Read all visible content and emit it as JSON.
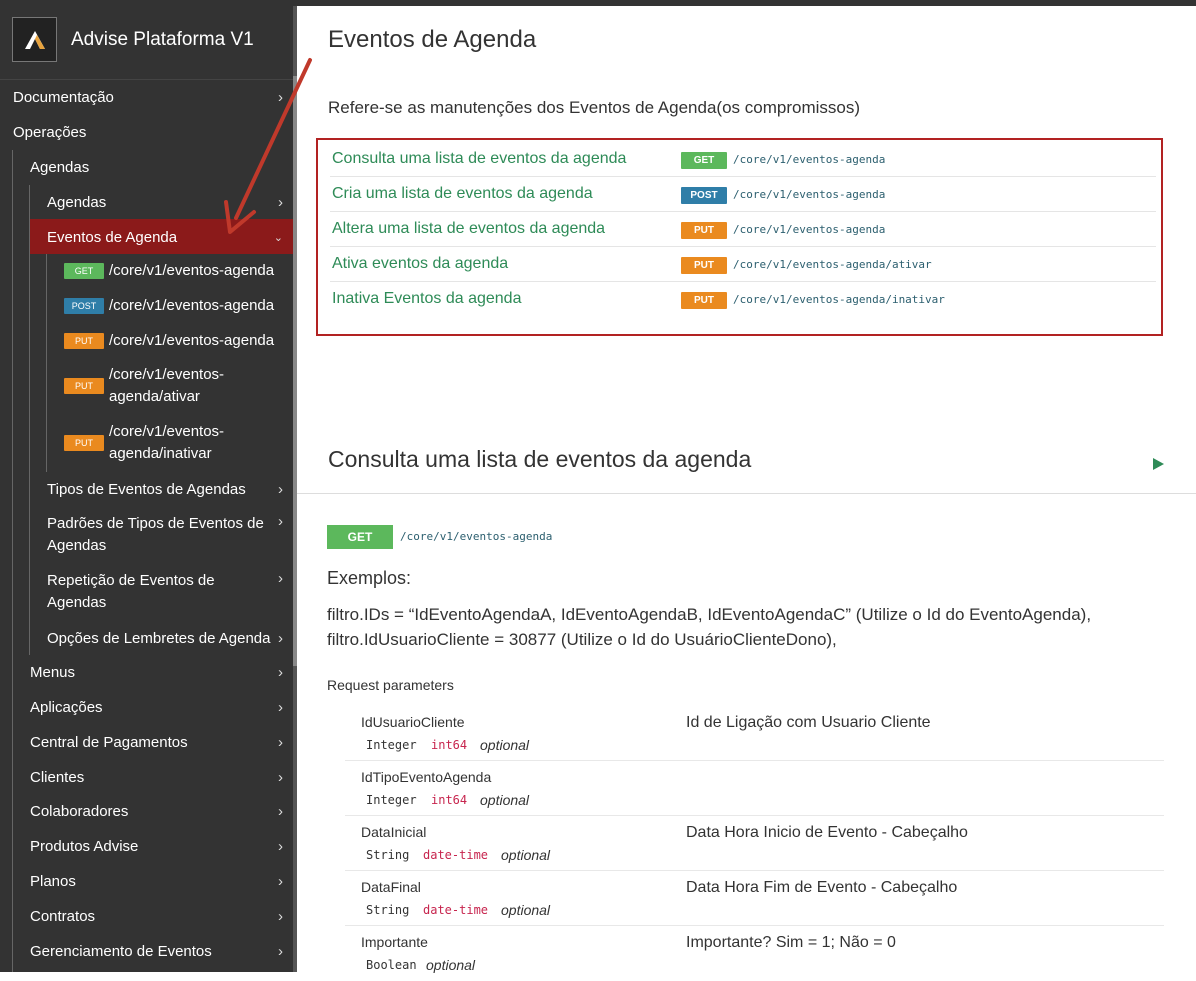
{
  "app": {
    "title": "Advise Plataforma V1"
  },
  "sidebar": {
    "top_items": [
      {
        "label": "Documentação"
      },
      {
        "label": "Operações"
      }
    ],
    "agendas_group": "Agendas",
    "agendas_children": [
      {
        "label": "Agendas"
      },
      {
        "label": "Eventos de Agenda"
      }
    ],
    "endpoints": [
      {
        "method": "GET",
        "path": "/core/v1/eventos-agenda"
      },
      {
        "method": "POST",
        "path": "/core/v1/eventos-agenda"
      },
      {
        "method": "PUT",
        "path": "/core/v1/eventos-agenda"
      },
      {
        "method": "PUT",
        "path": "/core/v1/eventos-agenda/ativar"
      },
      {
        "method": "PUT",
        "path": "/core/v1/eventos-agenda/inativar"
      }
    ],
    "more_children": [
      {
        "label": "Tipos de Eventos de Agendas"
      },
      {
        "label": "Padrões de Tipos de Eventos de Agendas"
      },
      {
        "label": "Repetição de Eventos de Agendas"
      },
      {
        "label": "Opções de Lembretes de Agenda"
      }
    ],
    "groups": [
      {
        "label": "Menus"
      },
      {
        "label": "Aplicações"
      },
      {
        "label": "Central de Pagamentos"
      },
      {
        "label": "Clientes"
      },
      {
        "label": "Colaboradores"
      },
      {
        "label": "Produtos Advise"
      },
      {
        "label": "Planos"
      },
      {
        "label": "Contratos"
      },
      {
        "label": "Gerenciamento de Eventos"
      }
    ]
  },
  "main": {
    "title": "Eventos de Agenda",
    "description": "Refere-se as manutenções dos Eventos de Agenda(os compromissos)",
    "endpoints": [
      {
        "name": "Consulta uma lista de eventos da agenda",
        "method": "GET",
        "path": "/core/v1/eventos-agenda"
      },
      {
        "name": "Cria uma lista de eventos da agenda",
        "method": "POST",
        "path": "/core/v1/eventos-agenda"
      },
      {
        "name": "Altera uma lista de eventos da agenda",
        "method": "PUT",
        "path": "/core/v1/eventos-agenda"
      },
      {
        "name": "Ativa eventos da agenda",
        "method": "PUT",
        "path": "/core/v1/eventos-agenda/ativar"
      },
      {
        "name": "Inativa Eventos da agenda",
        "method": "PUT",
        "path": "/core/v1/eventos-agenda/inativar"
      }
    ],
    "detail": {
      "title": "Consulta uma lista de eventos da agenda",
      "method": "GET",
      "path": "/core/v1/eventos-agenda",
      "examples_label": "Exemplos:",
      "example_line1": "filtro.IDs = “IdEventoAgendaA, IdEventoAgendaB, IdEventoAgendaC” (Utilize o Id do EventoAgenda),",
      "example_line2": "filtro.IdUsuarioCliente = 30877 (Utilize o Id do UsuárioClienteDono),",
      "params_title": "Request parameters",
      "params": [
        {
          "name": "IdUsuarioCliente",
          "type": "Integer",
          "format": "int64",
          "optional": "optional",
          "description": "Id de Ligação com Usuario Cliente"
        },
        {
          "name": "IdTipoEventoAgenda",
          "type": "Integer",
          "format": "int64",
          "optional": "optional",
          "description": ""
        },
        {
          "name": "DataInicial",
          "type": "String",
          "format": "date-time",
          "optional": "optional",
          "description": "Data Hora Inicio de Evento - Cabeçalho"
        },
        {
          "name": "DataFinal",
          "type": "String",
          "format": "date-time",
          "optional": "optional",
          "description": "Data Hora Fim de Evento - Cabeçalho"
        },
        {
          "name": "Importante",
          "type": "Boolean",
          "format": "",
          "optional": "optional",
          "description": "Importante? Sim = 1; Não = 0"
        }
      ]
    }
  },
  "colors": {
    "get": "#5cb85c",
    "post": "#2f7ea8",
    "put": "#ea8a1f",
    "active": "#8b1a1a",
    "link": "#2e8b57",
    "highlight_box": "#b22222",
    "arrow": "#c0392b"
  }
}
